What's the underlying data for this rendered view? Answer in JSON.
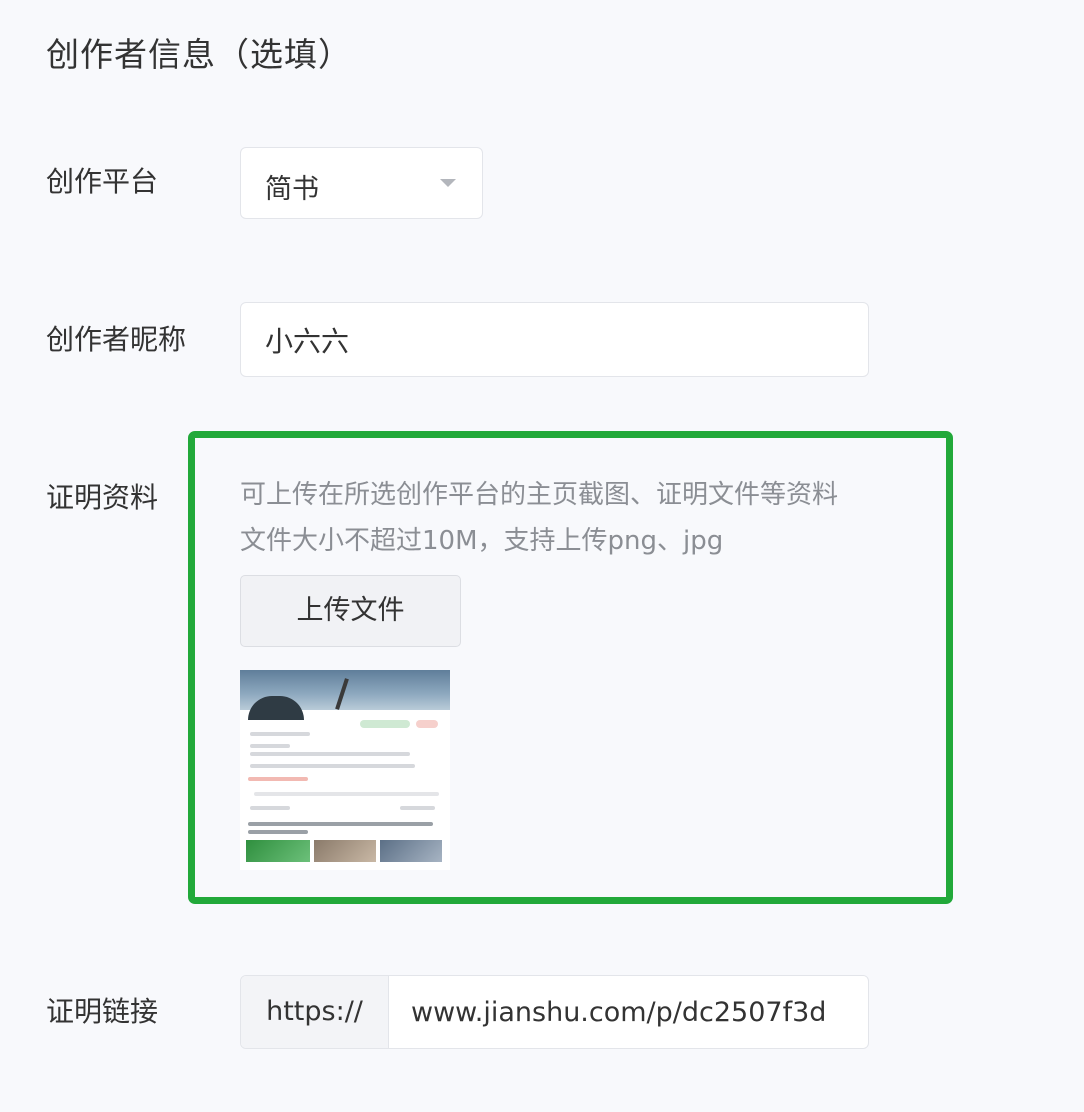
{
  "section": {
    "title": "创作者信息（选填）"
  },
  "platform": {
    "label": "创作平台",
    "value": "简书"
  },
  "nickname": {
    "label": "创作者昵称",
    "value": "小六六"
  },
  "proof": {
    "label": "证明资料",
    "hint_line1": "可上传在所选创作平台的主页截图、证明文件等资料",
    "hint_line2": "文件大小不超过10M，支持上传png、jpg",
    "upload_label": "上传文件"
  },
  "link": {
    "label": "证明链接",
    "prefix": "https://",
    "value": "www.jianshu.com/p/dc2507f3d"
  },
  "colors": {
    "highlight": "#22a93a",
    "hint_text": "#8b8e94",
    "background": "#f8f9fc"
  },
  "icons": {
    "select_caret": "caret-down-icon"
  }
}
